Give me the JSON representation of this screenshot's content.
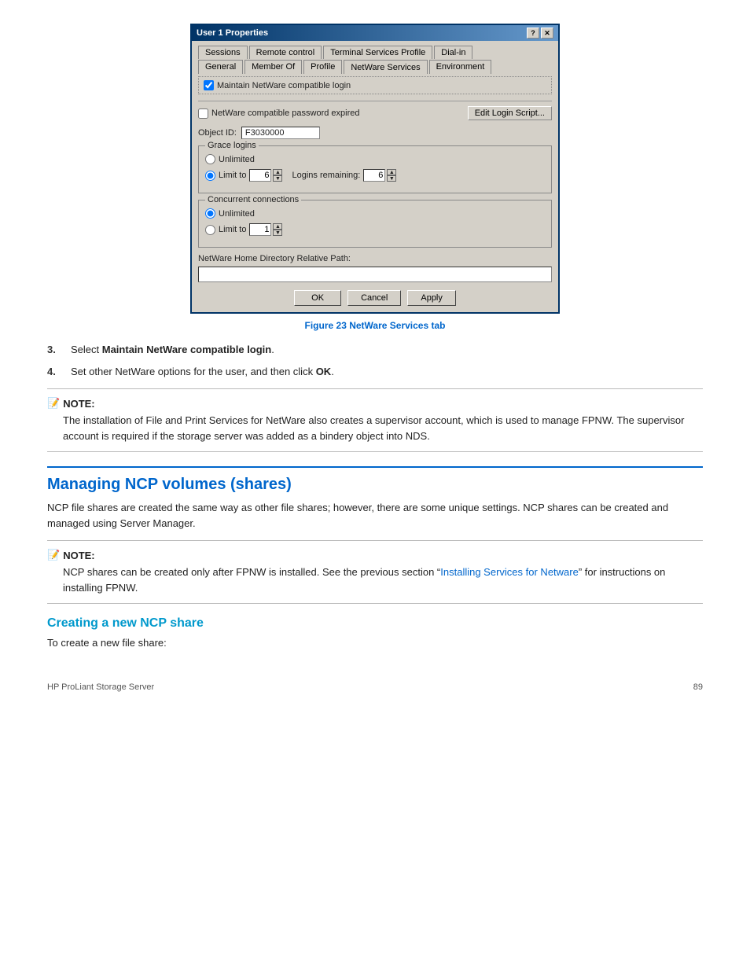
{
  "dialog": {
    "title": "User 1 Properties",
    "tabs_row1": [
      {
        "label": "Sessions"
      },
      {
        "label": "Remote control"
      },
      {
        "label": "Terminal Services Profile"
      },
      {
        "label": "Dial-in"
      }
    ],
    "tabs_row2": [
      {
        "label": "General"
      },
      {
        "label": "Member Of"
      },
      {
        "label": "Profile"
      },
      {
        "label": "NetWare Services"
      },
      {
        "label": "Environment"
      }
    ],
    "active_tab": "NetWare Services",
    "maintain_netware_checkbox": true,
    "maintain_netware_label": "Maintain NetWare compatible login",
    "netware_password_expired_label": "NetWare compatible password expired",
    "edit_login_script_btn": "Edit Login Script...",
    "object_id_label": "Object ID:",
    "object_id_value": "F3030000",
    "grace_logins_group": "Grace logins",
    "grace_unlimited_label": "Unlimited",
    "grace_limit_to_label": "Limit to",
    "grace_limit_value": "6",
    "logins_remaining_label": "Logins remaining:",
    "logins_remaining_value": "6",
    "concurrent_group": "Concurrent connections",
    "concurrent_unlimited_label": "Unlimited",
    "concurrent_limit_to_label": "Limit to",
    "concurrent_limit_value": "1",
    "netware_home_dir_label": "NetWare Home Directory Relative Path:",
    "netware_home_dir_value": "",
    "ok_btn": "OK",
    "cancel_btn": "Cancel",
    "apply_btn": "Apply"
  },
  "figure_caption": "Figure 23 NetWare Services tab",
  "steps": [
    {
      "number": "3.",
      "text_before": "Select ",
      "bold": "Maintain NetWare compatible login",
      "text_after": "."
    },
    {
      "number": "4.",
      "text_before": "Set other NetWare options for the user, and then click ",
      "bold": "OK",
      "text_after": "."
    }
  ],
  "note1": {
    "header": "NOTE:",
    "text": "The installation of File and Print Services for NetWare also creates a supervisor account, which is used to manage FPNW. The supervisor account is required if the storage server was added as a bindery object into NDS."
  },
  "section_main": "Managing NCP volumes (shares)",
  "section_main_body": "NCP file shares are created the same way as other file shares; however, there are some unique settings. NCP shares can be created and managed using Server Manager.",
  "note2": {
    "header": "NOTE:",
    "text_before": "NCP shares can be created only after FPNW is installed.  See the previous section “",
    "link": "Installing Services for Netware",
    "text_after": "” for instructions on installing FPNW."
  },
  "section_sub": "Creating a new NCP share",
  "section_sub_body": "To create a new file share:",
  "footer": {
    "brand": "HP ProLiant Storage Server",
    "page": "89"
  }
}
